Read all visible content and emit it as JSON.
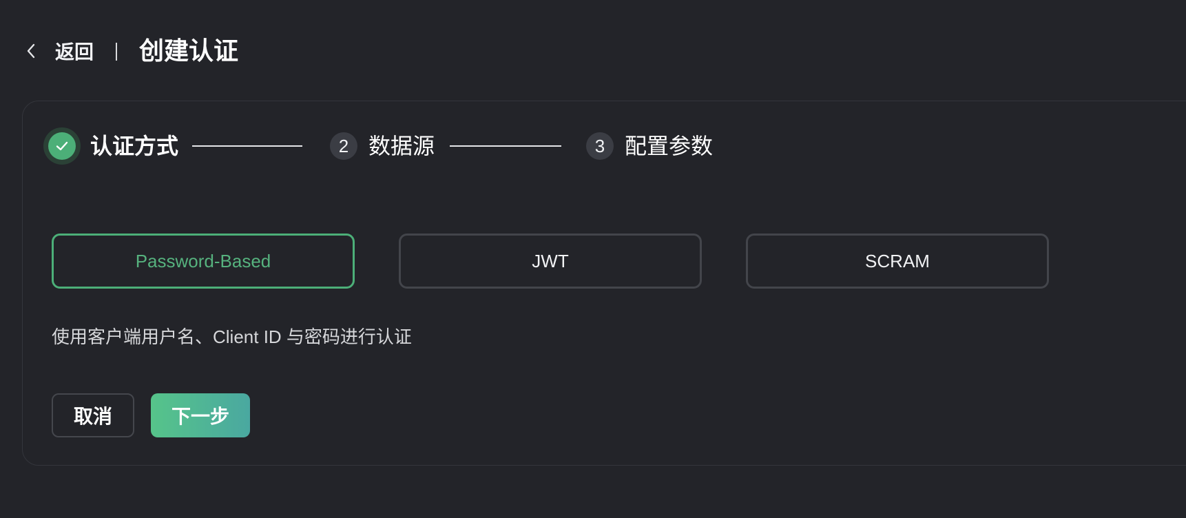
{
  "header": {
    "back_label": "返回",
    "title": "创建认证"
  },
  "steps": [
    {
      "number": "1",
      "label": "认证方式",
      "status": "done"
    },
    {
      "number": "2",
      "label": "数据源",
      "status": "pending"
    },
    {
      "number": "3",
      "label": "配置参数",
      "status": "pending"
    }
  ],
  "methods": [
    {
      "label": "Password-Based",
      "selected": true
    },
    {
      "label": "JWT",
      "selected": false
    },
    {
      "label": "SCRAM",
      "selected": false
    }
  ],
  "description": "使用客户端用户名、Client ID 与密码进行认证",
  "actions": {
    "cancel_label": "取消",
    "next_label": "下一步"
  },
  "colors": {
    "background": "#232429",
    "accent": "#4caf78",
    "accent_text": "#56b27e",
    "border": "#43454b"
  },
  "icons": {
    "back": "chevron-left-icon",
    "step_done": "check-icon"
  }
}
